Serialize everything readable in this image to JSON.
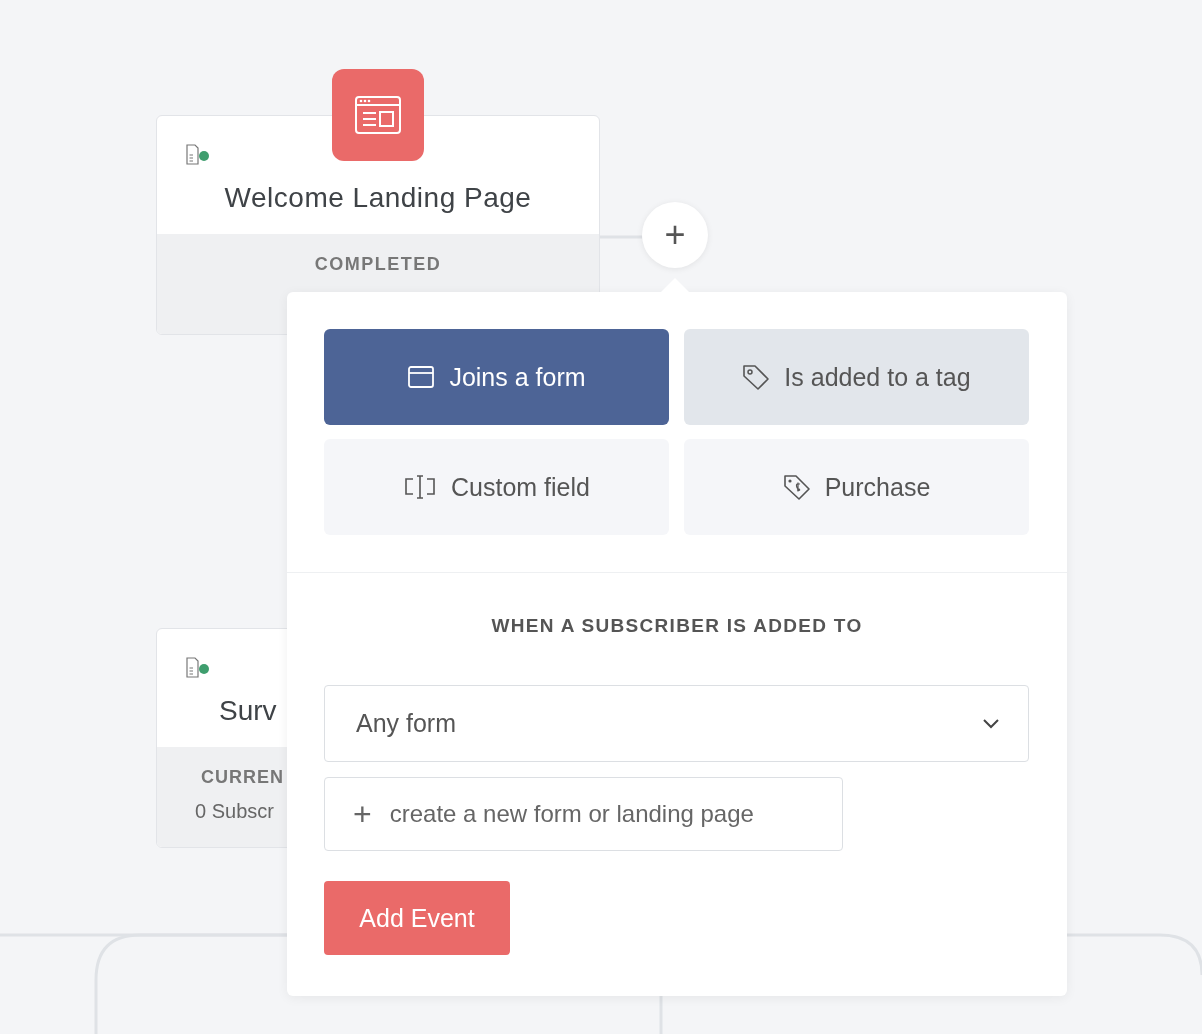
{
  "landing_card": {
    "title": "Welcome Landing Page",
    "status": "COMPLETED"
  },
  "survey_card": {
    "title": "Surv",
    "status": "CURREN",
    "count": "0 Subscr"
  },
  "add_step_button": {
    "label": "+"
  },
  "event_popover": {
    "triggers": [
      {
        "kind": "form",
        "label": "Joins a form",
        "selected": true,
        "hovered": false
      },
      {
        "kind": "tag",
        "label": "Is added to a tag",
        "selected": false,
        "hovered": true
      },
      {
        "kind": "field",
        "label": "Custom field",
        "selected": false,
        "hovered": false
      },
      {
        "kind": "purchase",
        "label": "Purchase",
        "selected": false,
        "hovered": false
      }
    ],
    "section_heading": "WHEN A SUBSCRIBER IS ADDED TO",
    "select": {
      "value": "Any form"
    },
    "create_link": {
      "icon": "+",
      "label": "create a new form or landing page"
    },
    "submit_button": "Add Event"
  }
}
